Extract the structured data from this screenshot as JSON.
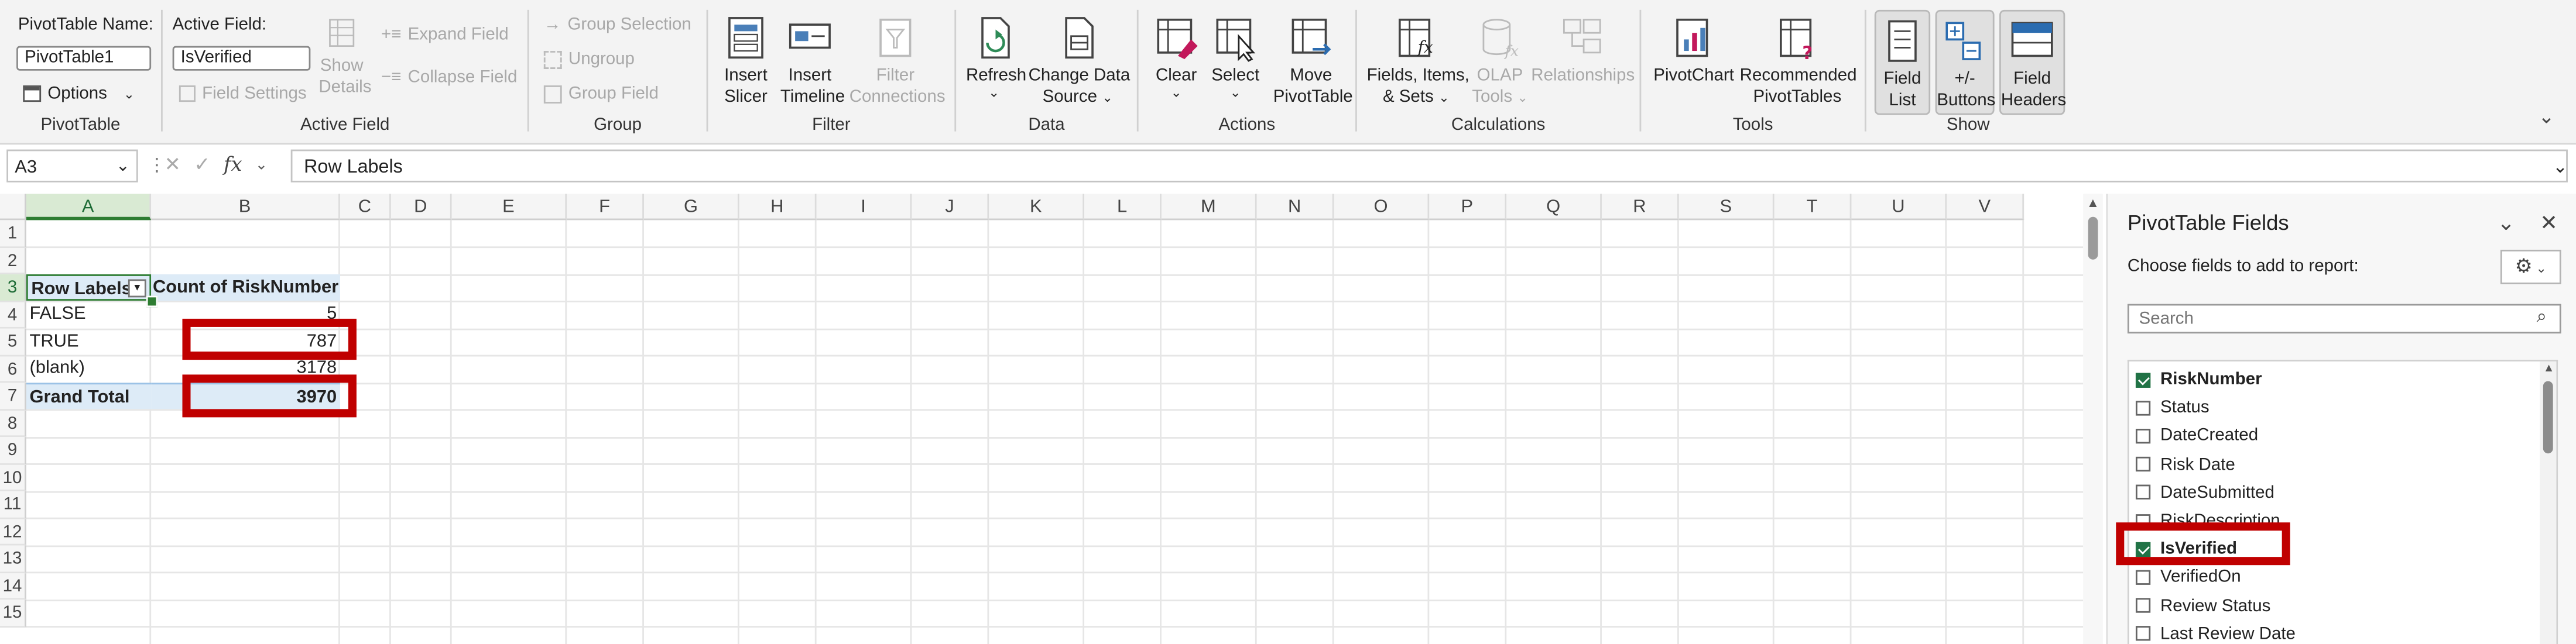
{
  "ribbon": {
    "pivottable": {
      "name_label": "PivotTable Name:",
      "name_value": "PivotTable1",
      "options_label": "Options",
      "group_label": "PivotTable"
    },
    "active_field": {
      "label": "Active Field:",
      "value": "IsVerified",
      "field_settings": "Field Settings",
      "show_details_1": "Show",
      "show_details_2": "Details",
      "expand_field": "Expand Field",
      "collapse_field": "Collapse Field",
      "group_label": "Active Field"
    },
    "group": {
      "group_selection": "Group Selection",
      "ungroup": "Ungroup",
      "group_field": "Group Field",
      "group_label": "Group"
    },
    "filter": {
      "insert_slicer_1": "Insert",
      "insert_slicer_2": "Slicer",
      "insert_timeline_1": "Insert",
      "insert_timeline_2": "Timeline",
      "filter_conn_1": "Filter",
      "filter_conn_2": "Connections",
      "group_label": "Filter"
    },
    "data": {
      "refresh": "Refresh",
      "change_source_1": "Change Data",
      "change_source_2": "Source",
      "group_label": "Data"
    },
    "actions": {
      "clear": "Clear",
      "select": "Select",
      "move_1": "Move",
      "move_2": "PivotTable",
      "group_label": "Actions"
    },
    "calculations": {
      "fields_items_1": "Fields, Items,",
      "fields_items_2": "& Sets",
      "olap_1": "OLAP",
      "olap_2": "Tools",
      "relationships": "Relationships",
      "group_label": "Calculations"
    },
    "tools": {
      "pivotchart": "PivotChart",
      "recommended_1": "Recommended",
      "recommended_2": "PivotTables",
      "group_label": "Tools"
    },
    "show": {
      "field_list_1": "Field",
      "field_list_2": "List",
      "buttons_1": "+/-",
      "buttons_2": "Buttons",
      "headers_1": "Field",
      "headers_2": "Headers",
      "group_label": "Show"
    }
  },
  "formula_bar": {
    "name_box": "A3",
    "formula": "Row Labels",
    "fx": "fx"
  },
  "grid": {
    "columns": [
      "A",
      "B",
      "C",
      "D",
      "E",
      "F",
      "G",
      "H",
      "I",
      "J",
      "K",
      "L",
      "M",
      "N",
      "O",
      "P",
      "Q",
      "R",
      "S",
      "T",
      "U",
      "V"
    ],
    "rows": [
      "1",
      "2",
      "3",
      "4",
      "5",
      "6",
      "7",
      "8",
      "9",
      "10",
      "11",
      "12",
      "13",
      "14",
      "15"
    ],
    "pivot": {
      "header_a": "Row Labels",
      "header_b": "Count of RiskNumber",
      "r4_a": "FALSE",
      "r4_b": "5",
      "r5_a": "TRUE",
      "r5_b": "787",
      "r6_a": "(blank)",
      "r6_b": "3178",
      "r7_a": "Grand Total",
      "r7_b": "3970"
    }
  },
  "pane": {
    "title": "PivotTable Fields",
    "subtitle": "Choose fields to add to report:",
    "search_placeholder": "Search",
    "fields": [
      {
        "label": "RiskNumber",
        "checked": true
      },
      {
        "label": "Status",
        "checked": false
      },
      {
        "label": "DateCreated",
        "checked": false
      },
      {
        "label": "Risk Date",
        "checked": false
      },
      {
        "label": "DateSubmitted",
        "checked": false
      },
      {
        "label": "RiskDescription",
        "checked": false
      },
      {
        "label": "IsVerified",
        "checked": true
      },
      {
        "label": "VerifiedOn",
        "checked": false
      },
      {
        "label": "Review Status",
        "checked": false
      },
      {
        "label": "Last Review Date",
        "checked": false
      }
    ]
  },
  "colors": {
    "excel_green": "#217346",
    "highlight_red": "#c00000",
    "pivot_header_fill": "#ddebf7"
  }
}
